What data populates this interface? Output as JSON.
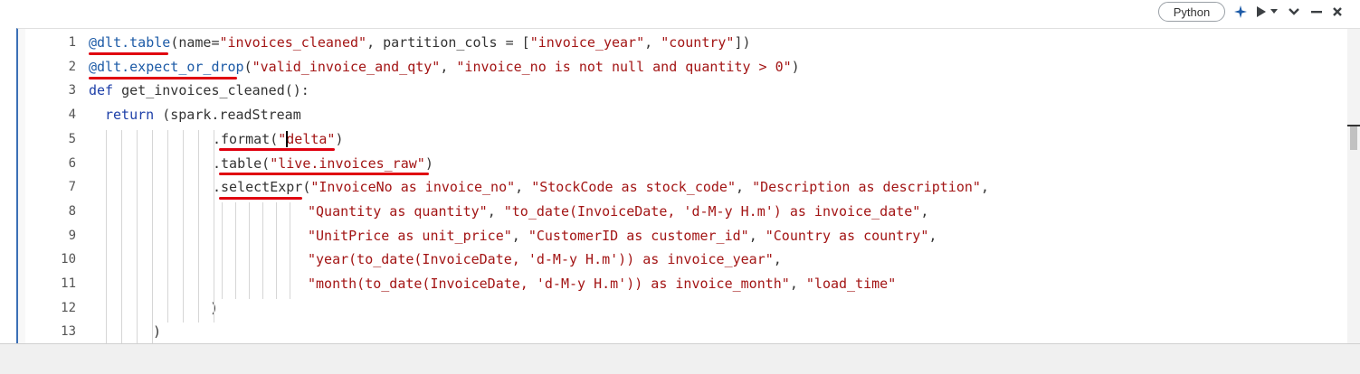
{
  "toolbar": {
    "language_label": "Python",
    "icons": [
      "sparkle-icon",
      "run-icon",
      "chevron-down-icon",
      "collapse-icon",
      "minimize-icon",
      "close-icon"
    ]
  },
  "annotation_color": "#e0000f",
  "cell_border_color": "#3b6fb6",
  "code": {
    "line_numbers": [
      "1",
      "2",
      "3",
      "4",
      "5",
      "6",
      "7",
      "8",
      "9",
      "10",
      "11",
      "12",
      "13"
    ],
    "lines": [
      [
        {
          "t": "@dlt.table",
          "c": "dec"
        },
        {
          "t": "(name=",
          "c": "fn"
        },
        {
          "t": "\"invoices_cleaned\"",
          "c": "str"
        },
        {
          "t": ", partition_cols = [",
          "c": "fn"
        },
        {
          "t": "\"invoice_year\"",
          "c": "str"
        },
        {
          "t": ", ",
          "c": "fn"
        },
        {
          "t": "\"country\"",
          "c": "str"
        },
        {
          "t": "])",
          "c": "fn"
        }
      ],
      [
        {
          "t": "@dlt.expect_or_drop",
          "c": "dec"
        },
        {
          "t": "(",
          "c": "fn"
        },
        {
          "t": "\"valid_invoice_and_qty\"",
          "c": "str"
        },
        {
          "t": ", ",
          "c": "fn"
        },
        {
          "t": "\"invoice_no is not null and quantity > 0\"",
          "c": "str"
        },
        {
          "t": ")",
          "c": "fn"
        }
      ],
      [
        {
          "t": "def ",
          "c": "kw"
        },
        {
          "t": "get_invoices_cleaned():",
          "c": "fn"
        }
      ],
      [
        {
          "t": "return ",
          "c": "kw"
        },
        {
          "t": "(spark.readStream",
          "c": "fn"
        }
      ],
      [
        {
          "t": ".format(",
          "c": "fn"
        },
        {
          "t": "\"delta\"",
          "c": "str"
        },
        {
          "t": ")",
          "c": "fn"
        }
      ],
      [
        {
          "t": ".table(",
          "c": "fn"
        },
        {
          "t": "\"live.invoices_raw\"",
          "c": "str"
        },
        {
          "t": ")",
          "c": "fn"
        }
      ],
      [
        {
          "t": ".selectExpr(",
          "c": "fn"
        },
        {
          "t": "\"InvoiceNo as invoice_no\"",
          "c": "str"
        },
        {
          "t": ", ",
          "c": "fn"
        },
        {
          "t": "\"StockCode as stock_code\"",
          "c": "str"
        },
        {
          "t": ", ",
          "c": "fn"
        },
        {
          "t": "\"Description as description\"",
          "c": "str"
        },
        {
          "t": ",",
          "c": "fn"
        }
      ],
      [
        {
          "t": "\"Quantity as quantity\"",
          "c": "str"
        },
        {
          "t": ", ",
          "c": "fn"
        },
        {
          "t": "\"to_date(InvoiceDate, 'd-M-y H.m') as invoice_date\"",
          "c": "str"
        },
        {
          "t": ",",
          "c": "fn"
        }
      ],
      [
        {
          "t": "\"UnitPrice as unit_price\"",
          "c": "str"
        },
        {
          "t": ", ",
          "c": "fn"
        },
        {
          "t": "\"CustomerID as customer_id\"",
          "c": "str"
        },
        {
          "t": ", ",
          "c": "fn"
        },
        {
          "t": "\"Country as country\"",
          "c": "str"
        },
        {
          "t": ",",
          "c": "fn"
        }
      ],
      [
        {
          "t": "\"year(to_date(InvoiceDate, 'd-M-y H.m')) as invoice_year\"",
          "c": "str"
        },
        {
          "t": ",",
          "c": "fn"
        }
      ],
      [
        {
          "t": "\"month(to_date(InvoiceDate, 'd-M-y H.m')) as invoice_month\"",
          "c": "str"
        },
        {
          "t": ", ",
          "c": "fn"
        },
        {
          "t": "\"load_time\"",
          "c": "str"
        }
      ],
      [
        {
          "t": ")",
          "c": "fn"
        }
      ],
      [
        {
          "t": ")",
          "c": "fn"
        }
      ]
    ]
  }
}
